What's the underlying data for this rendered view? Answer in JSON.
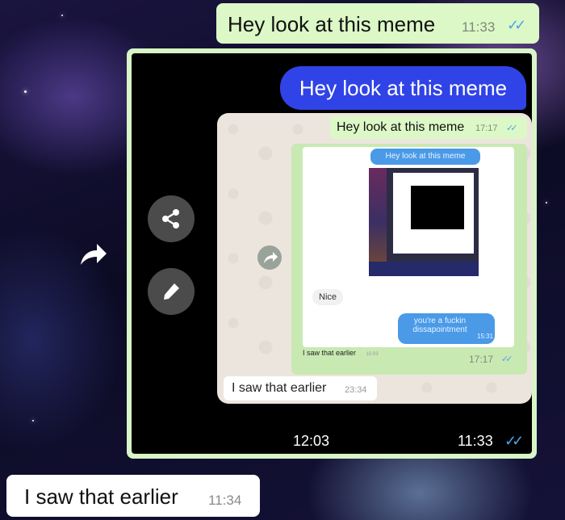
{
  "top_message": {
    "text": "Hey look at this meme",
    "time": "11:33",
    "ticks": "✓✓"
  },
  "screenshot": {
    "blue_message": "Hey look at this meme",
    "left_time": "12:03",
    "right_time": "11:33",
    "right_ticks": "✓✓",
    "icons": [
      "share-icon",
      "forward-icon",
      "edit-icon"
    ],
    "nested": {
      "green_message": {
        "text": "Hey look at this meme",
        "time": "17:17",
        "ticks": "✓✓"
      },
      "inner": {
        "blue_message": "Hey look at this meme",
        "nice_text": "Nice",
        "blue_reply": "you're a fuckin dissapointment",
        "blue_reply_time": "15:31",
        "saw_text": "I saw that earlier",
        "saw_time": "15:03",
        "image_time": "17:17",
        "image_ticks": "✓✓"
      },
      "bottom_message": {
        "text": "I saw that earlier",
        "time": "23:34"
      }
    }
  },
  "bottom_message": {
    "text": "I saw that earlier",
    "time": "11:34"
  },
  "colors": {
    "outgoing_bubble": "#dcf8c6",
    "incoming_bubble": "#ffffff",
    "blue_bubble": "#2f43e6",
    "ticks": "#4fa3e6"
  }
}
